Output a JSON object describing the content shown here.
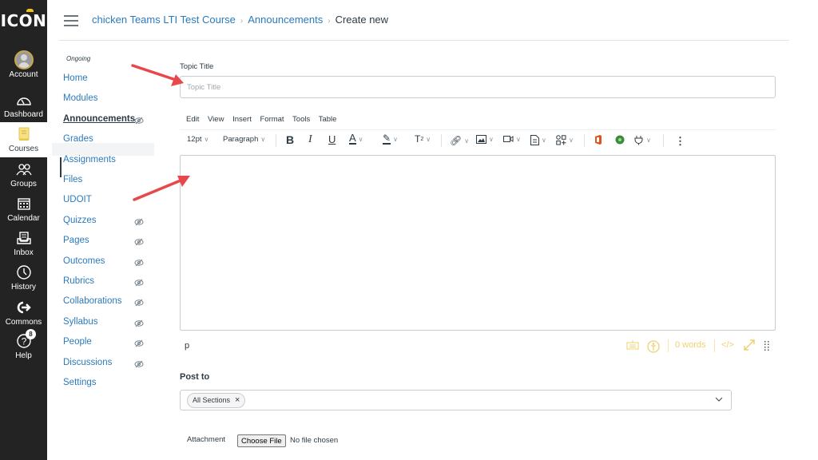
{
  "global_nav": {
    "logo": "ICON",
    "items": [
      {
        "label": "Account",
        "icon": "avatar"
      },
      {
        "label": "Dashboard",
        "icon": "dashboard-icon"
      },
      {
        "label": "Courses",
        "icon": "courses-icon",
        "active": true
      },
      {
        "label": "Groups",
        "icon": "groups-icon"
      },
      {
        "label": "Calendar",
        "icon": "calendar-icon"
      },
      {
        "label": "Inbox",
        "icon": "inbox-icon"
      },
      {
        "label": "History",
        "icon": "history-icon"
      },
      {
        "label": "Commons",
        "icon": "commons-icon"
      },
      {
        "label": "Help",
        "icon": "help-icon",
        "badge": "8"
      }
    ]
  },
  "breadcrumb": {
    "course": "chicken Teams LTI Test Course",
    "section": "Announcements",
    "current": "Create new",
    "separator": "›"
  },
  "course_nav": {
    "term": "Ongoing",
    "items": [
      {
        "label": "Home",
        "hidden": false
      },
      {
        "label": "Modules",
        "hidden": false
      },
      {
        "label": "Announcements",
        "hidden": true,
        "active": true
      },
      {
        "label": "Grades",
        "hidden": false
      },
      {
        "label": "Assignments",
        "hidden": false
      },
      {
        "label": "Files",
        "hidden": false
      },
      {
        "label": "UDOIT",
        "hidden": false
      },
      {
        "label": "Quizzes",
        "hidden": true
      },
      {
        "label": "Pages",
        "hidden": true
      },
      {
        "label": "Outcomes",
        "hidden": true
      },
      {
        "label": "Rubrics",
        "hidden": true
      },
      {
        "label": "Collaborations",
        "hidden": true
      },
      {
        "label": "Syllabus",
        "hidden": true
      },
      {
        "label": "People",
        "hidden": true
      },
      {
        "label": "Discussions",
        "hidden": true
      },
      {
        "label": "Settings",
        "hidden": false
      }
    ]
  },
  "form": {
    "topic_title_label": "Topic Title",
    "topic_title_placeholder": "Topic Title",
    "topic_title_value": "",
    "menubar": [
      "Edit",
      "View",
      "Insert",
      "Format",
      "Tools",
      "Table"
    ],
    "font_size": "12pt",
    "block_format": "Paragraph",
    "status_path": "p",
    "word_count": "0 words",
    "html_toggle": "</>",
    "post_to_label": "Post to",
    "post_to_selected": "All Sections",
    "attachment_label": "Attachment",
    "choose_file_label": "Choose File",
    "no_file_text": "No file chosen"
  },
  "colors": {
    "accent_link": "#2b7abc",
    "nav_bg": "#232323",
    "annotation_arrow": "#e8484b",
    "status_icons": "#f0d070"
  }
}
